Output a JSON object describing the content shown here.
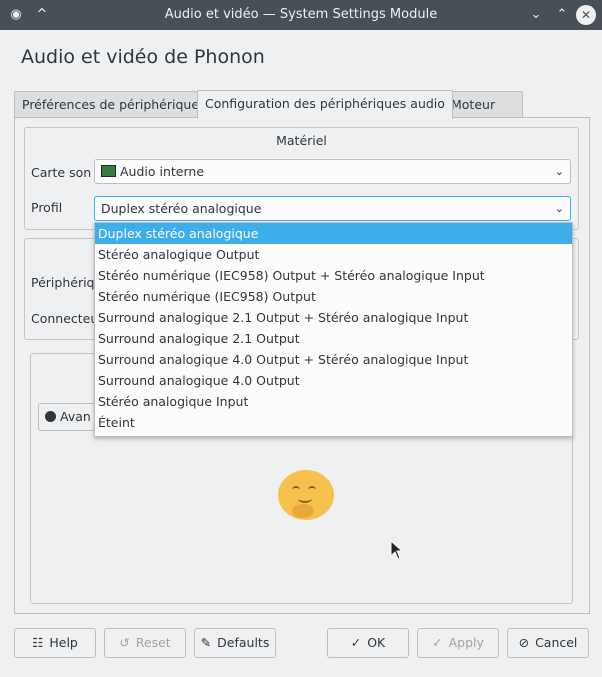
{
  "window": {
    "title": "Audio et vidéo — System Settings Module",
    "pin_icon": "^",
    "minimize_icon": "⌄",
    "maximize_icon": "⌃",
    "close_icon": "✕"
  },
  "heading": "Audio et vidéo de Phonon",
  "tabs": [
    {
      "label": "Préférences de périphérique"
    },
    {
      "label": "Configuration des périphériques audio"
    },
    {
      "label": "Moteur"
    }
  ],
  "hardware": {
    "title": "Matériel",
    "sound_card_label": "Carte son",
    "sound_card_value": "Audio interne",
    "profile_label": "Profil",
    "profile_value": "Duplex stéréo analogique"
  },
  "device_group": {
    "device_label_partial": "Périphériqu",
    "connector_label_partial": "Connecteu"
  },
  "test": {
    "button_partial": "Avan"
  },
  "profile_options": [
    "Duplex stéréo analogique",
    "Stéréo analogique Output",
    "Stéréo numérique (IEC958) Output + Stéréo analogique Input",
    "Stéréo numérique (IEC958) Output",
    "Surround analogique 2.1 Output + Stéréo analogique Input",
    "Surround analogique 2.1 Output",
    "Surround analogique 4.0 Output + Stéréo analogique Input",
    "Surround analogique 4.0 Output",
    "Stéréo analogique Input",
    "Éteint"
  ],
  "selected_profile_index": 0,
  "buttons": {
    "help": "Help",
    "reset": "Reset",
    "defaults": "Defaults",
    "ok": "OK",
    "apply": "Apply",
    "cancel": "Cancel"
  },
  "colors": {
    "accent": "#3daee9",
    "titlebar": "#475057",
    "window_bg": "#eff0f1"
  }
}
